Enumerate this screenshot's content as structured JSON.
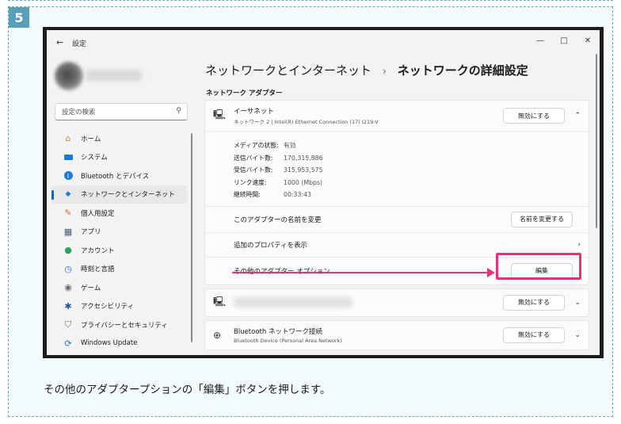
{
  "step": {
    "number": "5"
  },
  "caption": "その他のアダプタープションの「編集」ボタンを押します。",
  "window": {
    "title": "設定",
    "controls": {
      "minimize": "—",
      "maximize": "□",
      "close": "✕"
    }
  },
  "sidebar": {
    "search_placeholder": "設定の検索",
    "items": [
      {
        "label": "ホーム",
        "icon": "home-icon"
      },
      {
        "label": "システム",
        "icon": "system-icon"
      },
      {
        "label": "Bluetooth とデバイス",
        "icon": "bluetooth-icon"
      },
      {
        "label": "ネットワークとインターネット",
        "icon": "network-icon",
        "active": true
      },
      {
        "label": "個人用設定",
        "icon": "brush-icon"
      },
      {
        "label": "アプリ",
        "icon": "apps-icon"
      },
      {
        "label": "アカウント",
        "icon": "account-icon"
      },
      {
        "label": "時刻と言語",
        "icon": "time-icon"
      },
      {
        "label": "ゲーム",
        "icon": "game-icon"
      },
      {
        "label": "アクセシビリティ",
        "icon": "accessibility-icon"
      },
      {
        "label": "プライバシーとセキュリティ",
        "icon": "shield-icon"
      },
      {
        "label": "Windows Update",
        "icon": "update-icon"
      }
    ]
  },
  "breadcrumb": {
    "parent": "ネットワークとインターネット",
    "separator": "›",
    "current": "ネットワークの詳細設定"
  },
  "section_label": "ネットワーク アダプター",
  "ethernet": {
    "name": "イーサネット",
    "subtitle": "ネットワーク 2 | Intel(R) Ethernet Connection (17) I219-V",
    "disable_label": "無効にする",
    "props": [
      {
        "k": "メディアの状態:",
        "v": "有効"
      },
      {
        "k": "送信バイト数:",
        "v": "170,315,886"
      },
      {
        "k": "受信バイト数:",
        "v": "315,953,575"
      },
      {
        "k": "リンク速度:",
        "v": "1000 (Mbps)"
      },
      {
        "k": "継続時間:",
        "v": "00:33:43"
      }
    ],
    "rename_label": "このアダプターの名前を変更",
    "rename_button": "名前を変更する",
    "more_props_label": "追加のプロパティを表示",
    "more_options_label": "その他のアダプター オプション",
    "edit_button": "編集"
  },
  "second_adapter": {
    "disable_label": "無効にする"
  },
  "bluetooth_adapter": {
    "name": "Bluetooth ネットワーク接続",
    "subtitle": "Bluetooth Device (Personal Area Network)",
    "disable_label": "無効にする"
  },
  "colors": {
    "accent": "#0067c0",
    "highlight": "#e5337a",
    "badge": "#5a9fb8"
  }
}
